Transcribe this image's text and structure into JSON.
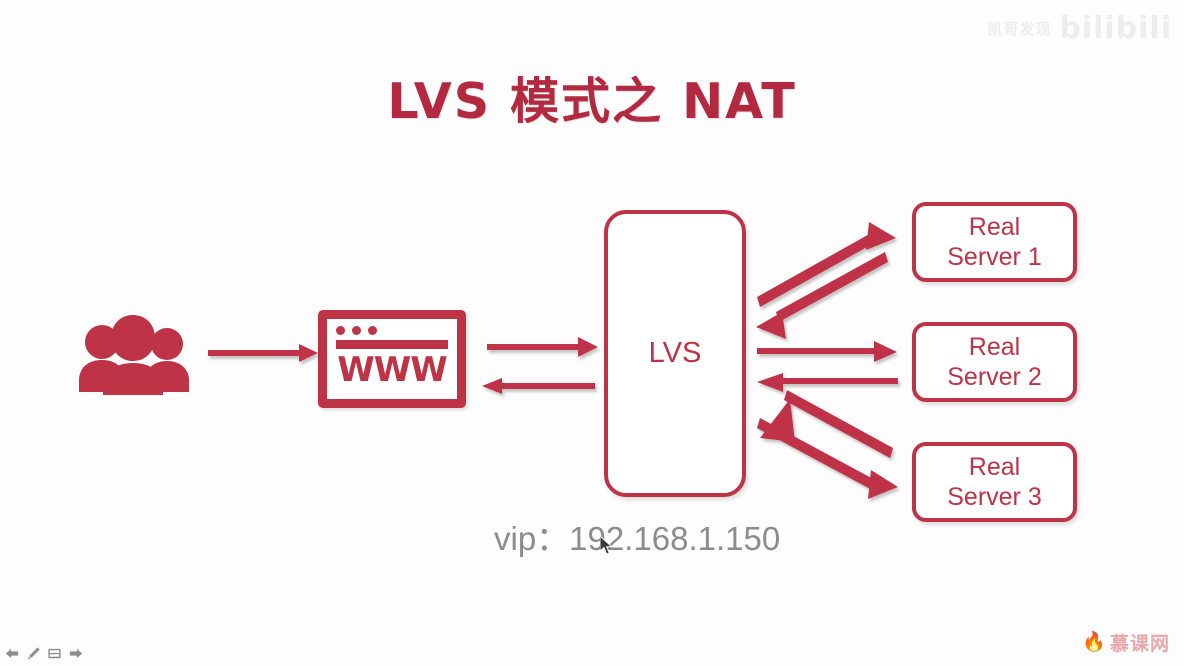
{
  "slide": {
    "title": "LVS 模式之 NAT",
    "title_color": "#b3293f",
    "accent_color": "#bf3346",
    "background": "#fdfdfd"
  },
  "nodes": {
    "users": {
      "icon": "users-group-icon",
      "label": ""
    },
    "browser": {
      "icon": "www-browser-icon",
      "label": "WWW",
      "dots": 3
    },
    "lvs": {
      "label": "LVS"
    },
    "real_servers": [
      {
        "line1": "Real",
        "line2": "Server 1"
      },
      {
        "line1": "Real",
        "line2": "Server 2"
      },
      {
        "line1": "Real",
        "line2": "Server 3"
      }
    ]
  },
  "labels": {
    "vip": "vip：192.168.1.150"
  },
  "connections": [
    {
      "from": "users",
      "to": "browser",
      "direction": "right"
    },
    {
      "from": "browser",
      "to": "lvs",
      "direction": "right"
    },
    {
      "from": "lvs",
      "to": "browser",
      "direction": "left"
    },
    {
      "from": "lvs",
      "to": "real-server-1",
      "direction": "up-right"
    },
    {
      "from": "real-server-1",
      "to": "lvs",
      "direction": "down-left"
    },
    {
      "from": "lvs",
      "to": "real-server-2",
      "direction": "right"
    },
    {
      "from": "real-server-2",
      "to": "lvs",
      "direction": "left"
    },
    {
      "from": "lvs",
      "to": "real-server-3",
      "direction": "down-right"
    },
    {
      "from": "real-server-3",
      "to": "lvs",
      "direction": "up-left"
    }
  ],
  "watermarks": {
    "top_right_brand": "bilibili",
    "top_right_sub": "凯哥发现",
    "bottom_right_brand": "慕课网"
  },
  "toolbar": {
    "items": [
      {
        "icon": "arrow-left-icon",
        "name": "previous-slide"
      },
      {
        "icon": "pencil-icon",
        "name": "annotate"
      },
      {
        "icon": "whiteboard-icon",
        "name": "whiteboard"
      },
      {
        "icon": "arrow-right-icon",
        "name": "next-slide"
      }
    ]
  }
}
